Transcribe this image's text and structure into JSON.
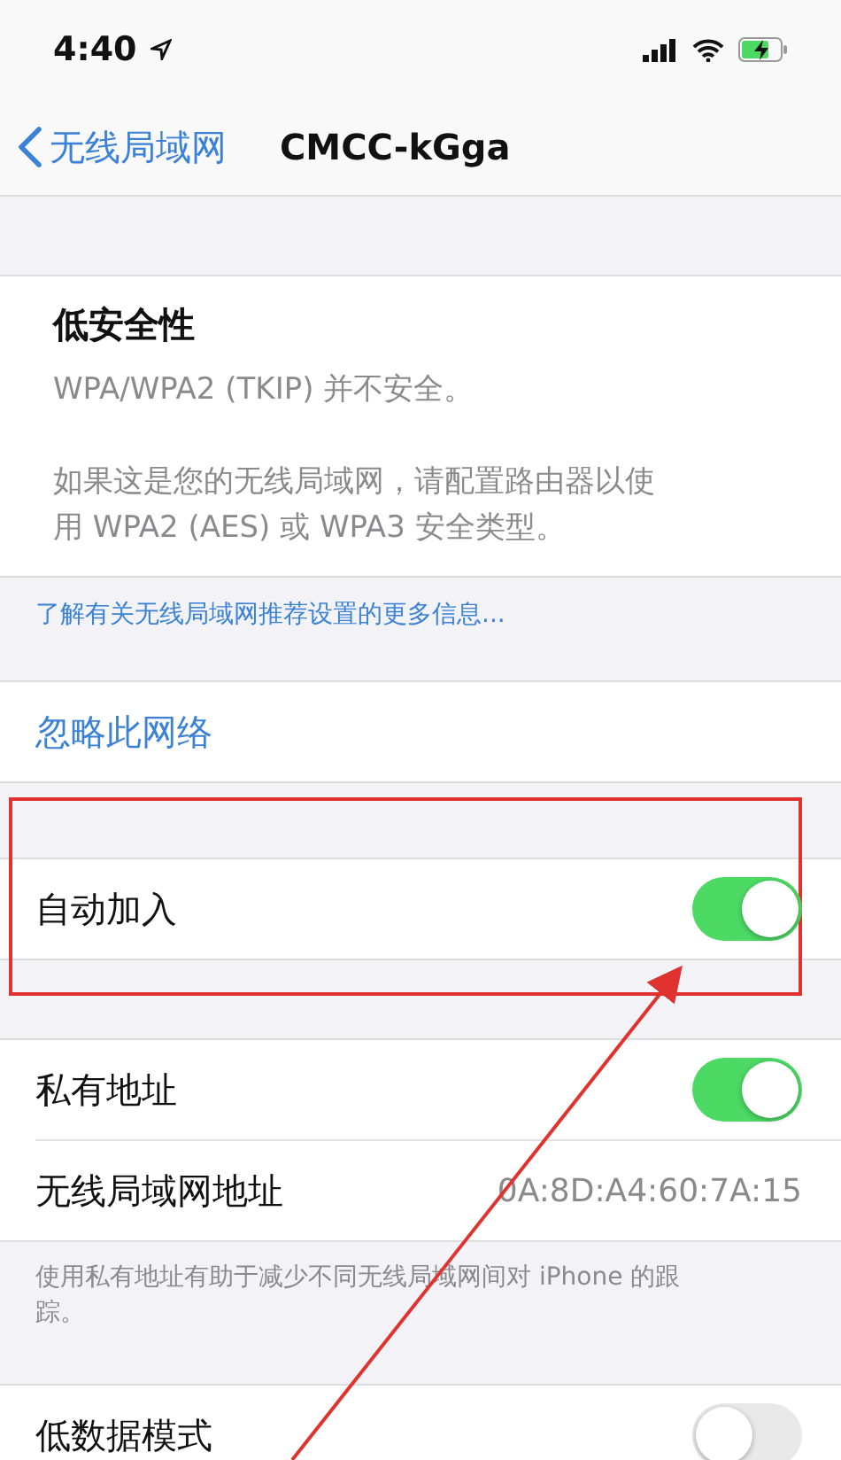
{
  "status_bar": {
    "time": "4:40"
  },
  "nav": {
    "back": "无线局域网",
    "title": "CMCC-kGga"
  },
  "security": {
    "title": "低安全性",
    "lines": [
      "WPA/WPA2 (TKIP) 并不安全。",
      "如果这是您的无线局域网，请配置路由器以使用 WPA2 (AES) 或 WPA3 安全类型。"
    ]
  },
  "security_link": "了解有关无线局域网推荐设置的更多信息...",
  "forget": "忽略此网络",
  "sections": [
    {
      "highlighted": true,
      "rows": [
        {
          "kind": "toggle",
          "label": "自动加入",
          "on": true
        }
      ]
    },
    {
      "highlighted": false,
      "rows": [
        {
          "kind": "toggle",
          "label": "私有地址",
          "on": true
        },
        {
          "kind": "value",
          "label": "无线局域网地址",
          "value": "0A:8D:A4:60:7A:15"
        }
      ],
      "footer": "使用私有地址有助于减少不同无线局域网间对 iPhone 的跟踪。"
    },
    {
      "highlighted": false,
      "rows": [
        {
          "kind": "toggle",
          "label": "低数据模式",
          "on": false
        }
      ]
    }
  ]
}
